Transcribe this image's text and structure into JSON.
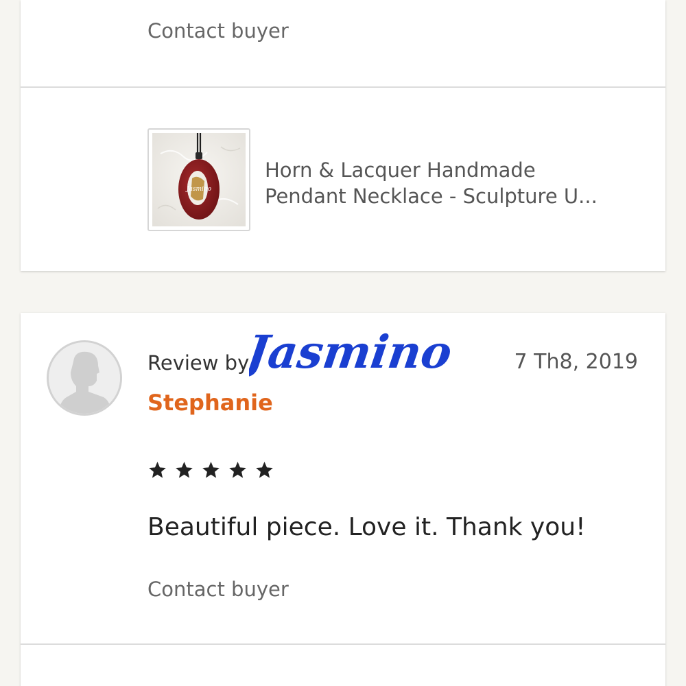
{
  "top_card": {
    "contact_label": "Contact buyer",
    "product": {
      "thumbnail_icon": "pendant-necklace-image",
      "thumbnail_signature": "Jasmino",
      "title_line1": "Horn & Lacquer Handmade",
      "title_line2": "Pendant Necklace - Sculpture U..."
    }
  },
  "review": {
    "avatar_icon": "default-user-avatar",
    "review_by_label": "Review by",
    "watermark": "Jasmino",
    "date": "7 Th8, 2019",
    "reviewer": "Stephanie",
    "rating": 5,
    "rating_max": 5,
    "text": "Beautiful piece. Love it. Thank you!",
    "contact_label": "Contact buyer"
  },
  "colors": {
    "background": "#f6f5f1",
    "reviewer_name": "#e0651c",
    "watermark": "#1a3fd1",
    "lacquer_red": "#8e1c1f"
  }
}
